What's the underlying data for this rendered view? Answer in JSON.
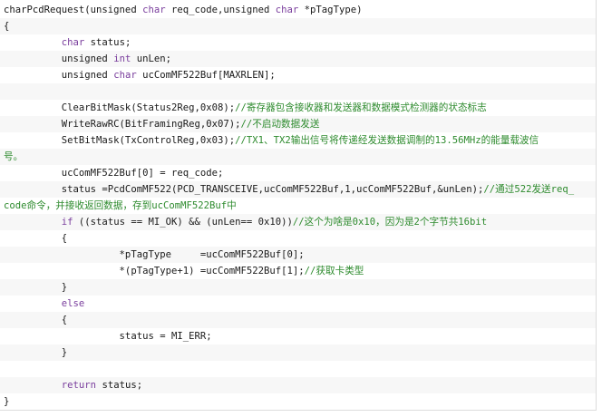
{
  "code_lines": [
    [
      {
        "t": "tx",
        "s": "charPcdRequest(unsigned "
      },
      {
        "t": "kw",
        "s": "char"
      },
      {
        "t": "tx",
        "s": " req_code,unsigned "
      },
      {
        "t": "kw",
        "s": "char"
      },
      {
        "t": "tx",
        "s": " *pTagType)"
      }
    ],
    [
      {
        "t": "tx",
        "s": "{"
      }
    ],
    [
      {
        "t": "tx",
        "s": "          "
      },
      {
        "t": "kw",
        "s": "char"
      },
      {
        "t": "tx",
        "s": " status;"
      }
    ],
    [
      {
        "t": "tx",
        "s": "          unsigned "
      },
      {
        "t": "kw",
        "s": "int"
      },
      {
        "t": "tx",
        "s": " unLen;"
      }
    ],
    [
      {
        "t": "tx",
        "s": "          unsigned "
      },
      {
        "t": "kw",
        "s": "char"
      },
      {
        "t": "tx",
        "s": " ucComMF522Buf[MAXRLEN];"
      }
    ],
    [],
    [
      {
        "t": "tx",
        "s": "          ClearBitMask(Status2Reg,0x08);"
      },
      {
        "t": "cm",
        "s": "//寄存器包含接收器和发送器和数据模式检测器的状态标志"
      }
    ],
    [
      {
        "t": "tx",
        "s": "          WriteRawRC(BitFramingReg,0x07);"
      },
      {
        "t": "cm",
        "s": "//不启动数据发送"
      }
    ],
    [
      {
        "t": "tx",
        "s": "          SetBitMask(TxControlReg,0x03);"
      },
      {
        "t": "cm",
        "s": "//TX1、TX2输出信号将传递经发送数据调制的13.56MHz的能量载波信"
      }
    ],
    [
      {
        "t": "cm",
        "s": "号。"
      }
    ],
    [
      {
        "t": "tx",
        "s": "          ucComMF522Buf[0] = req_code;"
      }
    ],
    [
      {
        "t": "tx",
        "s": "          status =PcdComMF522(PCD_TRANSCEIVE,ucComMF522Buf,1,ucComMF522Buf,&unLen);"
      },
      {
        "t": "cm",
        "s": "//通过522发送req_"
      }
    ],
    [
      {
        "t": "cm",
        "s": "code命令，并接收返回数据，存到ucComMF522Buf中"
      }
    ],
    [
      {
        "t": "tx",
        "s": "          "
      },
      {
        "t": "kw",
        "s": "if"
      },
      {
        "t": "tx",
        "s": " ((status == MI_OK) && (unLen== 0x10))"
      },
      {
        "t": "cm",
        "s": "//这个为啥是0x10，因为是2个字节共16bit"
      }
    ],
    [
      {
        "t": "tx",
        "s": "          {"
      }
    ],
    [
      {
        "t": "tx",
        "s": "                    *pTagType     =ucComMF522Buf[0];"
      }
    ],
    [
      {
        "t": "tx",
        "s": "                    *(pTagType+1) =ucComMF522Buf[1];"
      },
      {
        "t": "cm",
        "s": "//获取卡类型"
      }
    ],
    [
      {
        "t": "tx",
        "s": "          }"
      }
    ],
    [
      {
        "t": "tx",
        "s": "          "
      },
      {
        "t": "kw",
        "s": "else"
      }
    ],
    [
      {
        "t": "tx",
        "s": "          {"
      }
    ],
    [
      {
        "t": "tx",
        "s": "                    status = MI_ERR;"
      }
    ],
    [
      {
        "t": "tx",
        "s": "          }"
      }
    ],
    [],
    [
      {
        "t": "tx",
        "s": "          "
      },
      {
        "t": "kw",
        "s": "return"
      },
      {
        "t": "tx",
        "s": " status;"
      }
    ],
    [
      {
        "t": "tx",
        "s": "}"
      }
    ]
  ],
  "colors": {
    "keyword": "#7a3e9d",
    "comment": "#2e8b2e",
    "text": "#1a1a1a",
    "stripe": "#f7f7f7",
    "background": "#ffffff"
  }
}
